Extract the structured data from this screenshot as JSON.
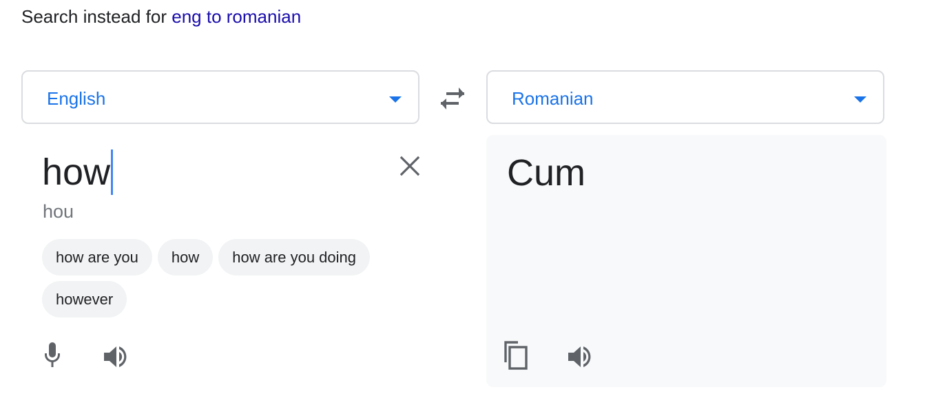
{
  "header": {
    "search_instead_prefix": "Search instead for",
    "search_instead_query": "eng to romanian"
  },
  "source": {
    "language": "English",
    "text": "how",
    "transliteration": "hou",
    "suggestions": [
      "how are you",
      "how",
      "how are you doing",
      "however"
    ]
  },
  "target": {
    "language": "Romanian",
    "text": "Cum"
  },
  "icons": {
    "swap": "swap-languages-icon",
    "clear": "close-icon",
    "mic": "microphone-icon",
    "speaker": "speaker-icon",
    "copy": "copy-icon"
  },
  "colors": {
    "accent": "#1a73e8",
    "link": "#1a0dab",
    "caret": "#4285f4"
  }
}
